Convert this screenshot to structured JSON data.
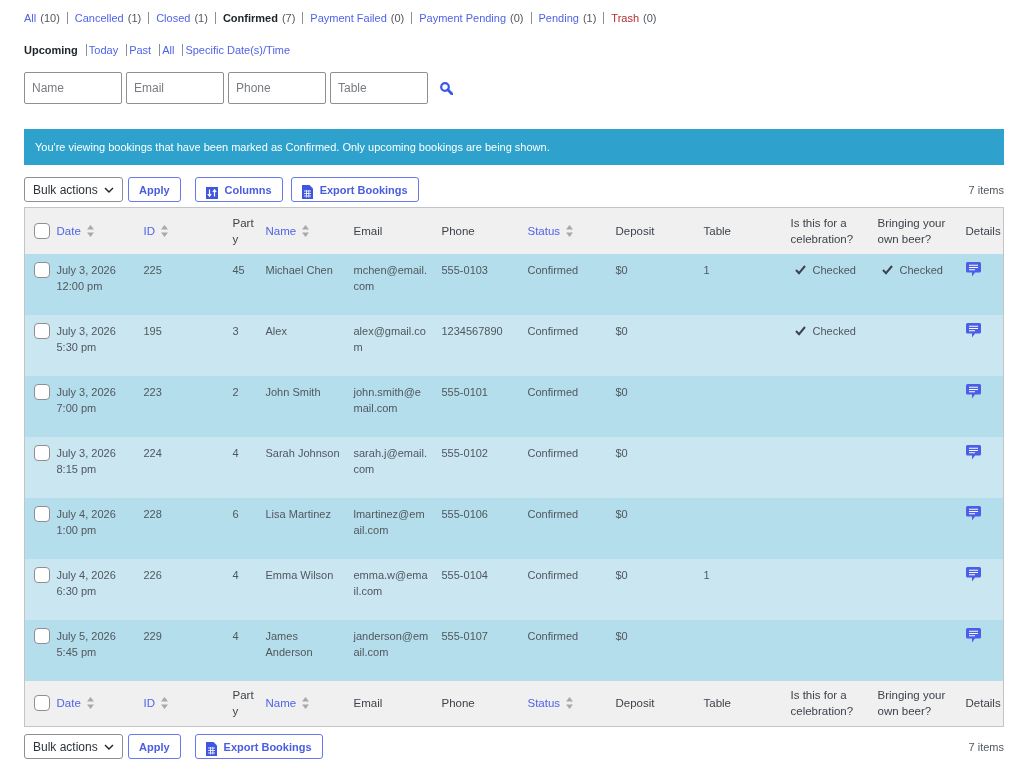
{
  "status_filters": [
    {
      "label": "All",
      "count": "(10)",
      "selected": false,
      "kind": "status"
    },
    {
      "label": "Cancelled",
      "count": "(1)",
      "selected": false,
      "kind": "status"
    },
    {
      "label": "Closed",
      "count": "(1)",
      "selected": false,
      "kind": "status"
    },
    {
      "label": "Confirmed",
      "count": "(7)",
      "selected": true,
      "kind": "status"
    },
    {
      "label": "Payment Failed",
      "count": "(0)",
      "selected": false,
      "kind": "status"
    },
    {
      "label": "Payment Pending",
      "count": "(0)",
      "selected": false,
      "kind": "status"
    },
    {
      "label": "Pending",
      "count": "(1)",
      "selected": false,
      "kind": "status"
    },
    {
      "label": "Trash",
      "count": "(0)",
      "selected": false,
      "kind": "trash"
    }
  ],
  "date_filters": [
    {
      "label": "Upcoming",
      "selected": true
    },
    {
      "label": "Today",
      "selected": false
    },
    {
      "label": "Past",
      "selected": false
    },
    {
      "label": "All",
      "selected": false
    },
    {
      "label": "Specific Date(s)/Time",
      "selected": false
    }
  ],
  "search": {
    "fields": [
      {
        "placeholder": "Name"
      },
      {
        "placeholder": "Email"
      },
      {
        "placeholder": "Phone"
      },
      {
        "placeholder": "Table"
      }
    ]
  },
  "notice": "You're viewing bookings that have been marked as Confirmed. Only upcoming bookings are being shown.",
  "top_toolbar": {
    "bulk_actions": "Bulk actions",
    "apply": "Apply",
    "buttons": [
      {
        "label": "Columns",
        "kind": "columns"
      },
      {
        "label": "Export Bookings",
        "kind": "export"
      }
    ],
    "count": "7 items"
  },
  "table": {
    "select_all_checked": false,
    "columns": [
      {
        "label": "Date",
        "sortable": true
      },
      {
        "label": "ID",
        "sortable": true
      },
      {
        "label": "Party",
        "sortable": false
      },
      {
        "label": "Name",
        "sortable": true
      },
      {
        "label": "Email",
        "sortable": false
      },
      {
        "label": "Phone",
        "sortable": false
      },
      {
        "label": "Status",
        "sortable": true
      },
      {
        "label": "Deposit",
        "sortable": false
      },
      {
        "label": "Table",
        "sortable": false
      },
      {
        "label": "Is this for a celebration?",
        "sortable": false
      },
      {
        "label": "Bringing your own beer?",
        "sortable": false
      },
      {
        "label": "Details",
        "sortable": false
      }
    ],
    "rows": [
      {
        "selected": false,
        "date": "July 3, 2026",
        "time": "12:00 pm",
        "id": "225",
        "party": "45",
        "name": "Michael Chen",
        "email": "mchen@email.com",
        "phone": "555-0103",
        "status": "Confirmed",
        "deposit": "$0",
        "table": "1",
        "celebration": "Checked",
        "beer": "Checked"
      },
      {
        "selected": false,
        "date": "July 3, 2026",
        "time": "5:30 pm",
        "id": "195",
        "party": "3",
        "name": "Alex",
        "email": "alex@gmail.com",
        "phone": "1234567890",
        "status": "Confirmed",
        "deposit": "$0",
        "celebration": "Checked"
      },
      {
        "selected": false,
        "date": "July 3, 2026",
        "time": "7:00 pm",
        "id": "223",
        "party": "2",
        "name": "John Smith",
        "email": "john.smith@email.com",
        "phone": "555-0101",
        "status": "Confirmed",
        "deposit": "$0"
      },
      {
        "selected": false,
        "date": "July 3, 2026",
        "time": "8:15 pm",
        "id": "224",
        "party": "4",
        "name": "Sarah Johnson",
        "email": "sarah.j@email.com",
        "phone": "555-0102",
        "status": "Confirmed",
        "deposit": "$0"
      },
      {
        "selected": false,
        "date": "July 4, 2026",
        "time": "1:00 pm",
        "id": "228",
        "party": "6",
        "name": "Lisa Martinez",
        "email": "lmartinez@email.com",
        "phone": "555-0106",
        "status": "Confirmed",
        "deposit": "$0"
      },
      {
        "selected": false,
        "date": "July 4, 2026",
        "time": "6:30 pm",
        "id": "226",
        "party": "4",
        "name": "Emma Wilson",
        "email": "emma.w@email.com",
        "phone": "555-0104",
        "status": "Confirmed",
        "deposit": "$0",
        "table": "1"
      },
      {
        "selected": false,
        "date": "July 5, 2026",
        "time": "5:45 pm",
        "id": "229",
        "party": "4",
        "name": "James Anderson",
        "email": "janderson@email.com",
        "phone": "555-0107",
        "status": "Confirmed",
        "deposit": "$0"
      }
    ],
    "footer_select_all_checked": false,
    "footer_columns": [
      {
        "label": "Date",
        "sortable": true
      },
      {
        "label": "ID",
        "sortable": true
      },
      {
        "label": "Party",
        "sortable": false
      },
      {
        "label": "Name",
        "sortable": true
      },
      {
        "label": "Email",
        "sortable": false
      },
      {
        "label": "Phone",
        "sortable": false
      },
      {
        "label": "Status",
        "sortable": true
      },
      {
        "label": "Deposit",
        "sortable": false
      },
      {
        "label": "Table",
        "sortable": false
      },
      {
        "label": "Is this for a celebration?",
        "sortable": false
      },
      {
        "label": "Bringing your own beer?",
        "sortable": false
      },
      {
        "label": "Details",
        "sortable": false
      }
    ]
  },
  "bottom_toolbar": {
    "bulk_actions": "Bulk actions",
    "apply": "Apply",
    "buttons": [
      {
        "label": "Export Bookings",
        "kind": "export"
      }
    ],
    "count": "7 items"
  }
}
